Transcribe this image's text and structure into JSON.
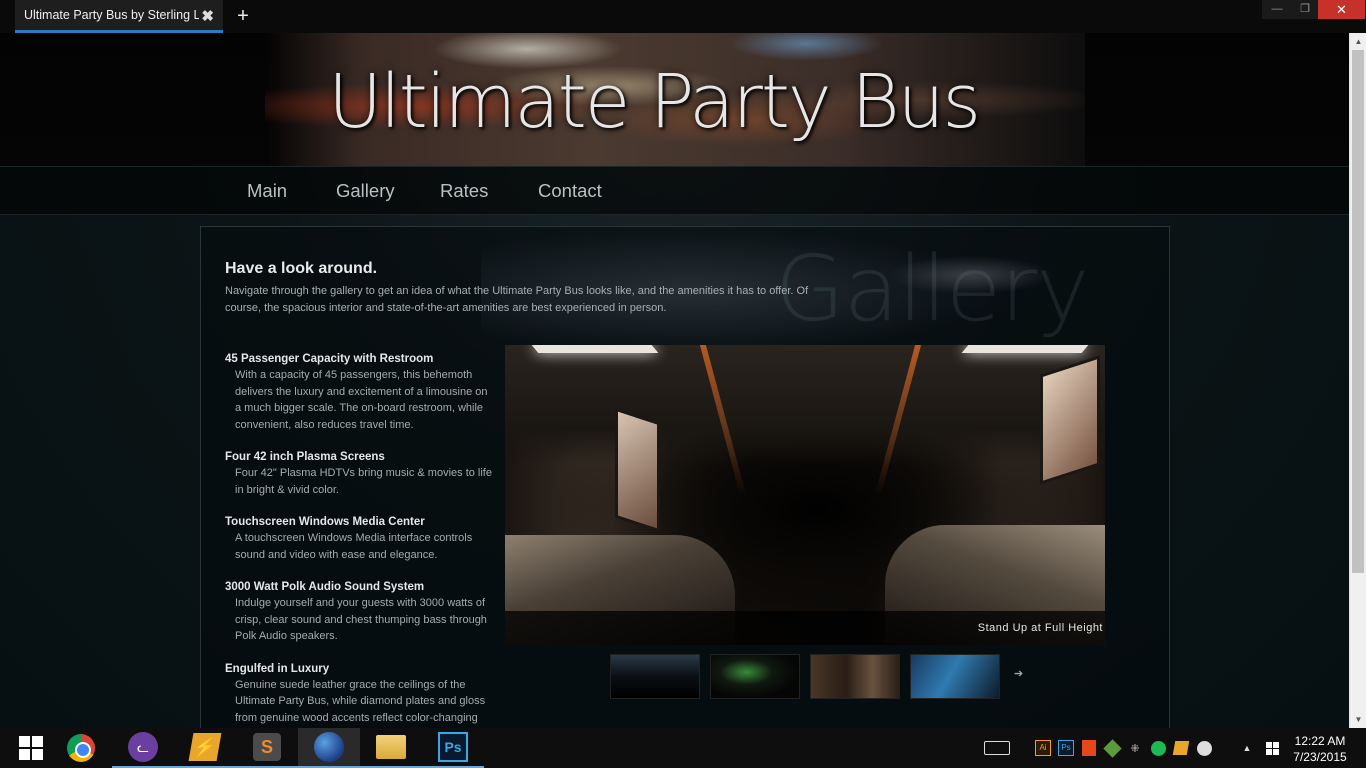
{
  "browser": {
    "tab_title": "Ultimate Party Bus by Sterling L...",
    "close_tab_glyph": "✖",
    "new_tab_glyph": "+",
    "window_buttons": {
      "minimize": "—",
      "maximize": "❐",
      "close": "✕"
    }
  },
  "site": {
    "title": "Ultimate Party Bus",
    "nav": [
      "Main",
      "Gallery",
      "Rates",
      "Contact"
    ],
    "watermark": "Gallery"
  },
  "content": {
    "heading": "Have a look around.",
    "intro": "Navigate through the gallery to get an idea of what the Ultimate Party Bus looks like, and the amenities it has to offer. Of course, the spacious interior and state-of-the-art amenities are best experienced in person.",
    "features": [
      {
        "title": "45 Passenger Capacity with Restroom",
        "desc": "With a capacity of 45 passengers, this behemoth delivers the luxury and excitement of a limousine on a much bigger scale. The on-board restroom, while convenient, also reduces travel time."
      },
      {
        "title": "Four 42 inch Plasma Screens",
        "desc": "Four 42\" Plasma HDTVs bring music & movies to life in bright & vivid color."
      },
      {
        "title": "Touchscreen Windows Media Center",
        "desc": "A touchscreen Windows Media interface controls sound and video with ease and elegance."
      },
      {
        "title": "3000 Watt Polk Audio Sound System",
        "desc": "Indulge yourself and your guests with 3000 watts of crisp, clear sound and chest thumping bass through Polk Audio speakers."
      },
      {
        "title": "Engulfed in Luxury",
        "desc": "Genuine suede leather grace the ceilings of the Ultimate Party Bus, while diamond plates and gloss from genuine wood accents reflect color-changing"
      }
    ],
    "gallery": {
      "caption": "Stand Up at Full Height",
      "next_glyph": "➔"
    }
  },
  "scrollbar": {
    "up": "▲",
    "down": "▼"
  },
  "taskbar": {
    "apps": [
      "start",
      "chrome",
      "cat-app",
      "winamp",
      "sublime-text",
      "firefox",
      "file-explorer",
      "photoshop"
    ],
    "sublime_glyph": "S",
    "winamp_glyph": "⚡",
    "cat_glyph": "ᓚ",
    "photoshop_label": "Ps",
    "tray": {
      "illustrator": "Ai",
      "photoshop": "Ps",
      "network_glyph": "⁜",
      "chevron": "▲"
    },
    "clock": {
      "time": "12:22 AM",
      "date": "7/23/2015"
    }
  }
}
